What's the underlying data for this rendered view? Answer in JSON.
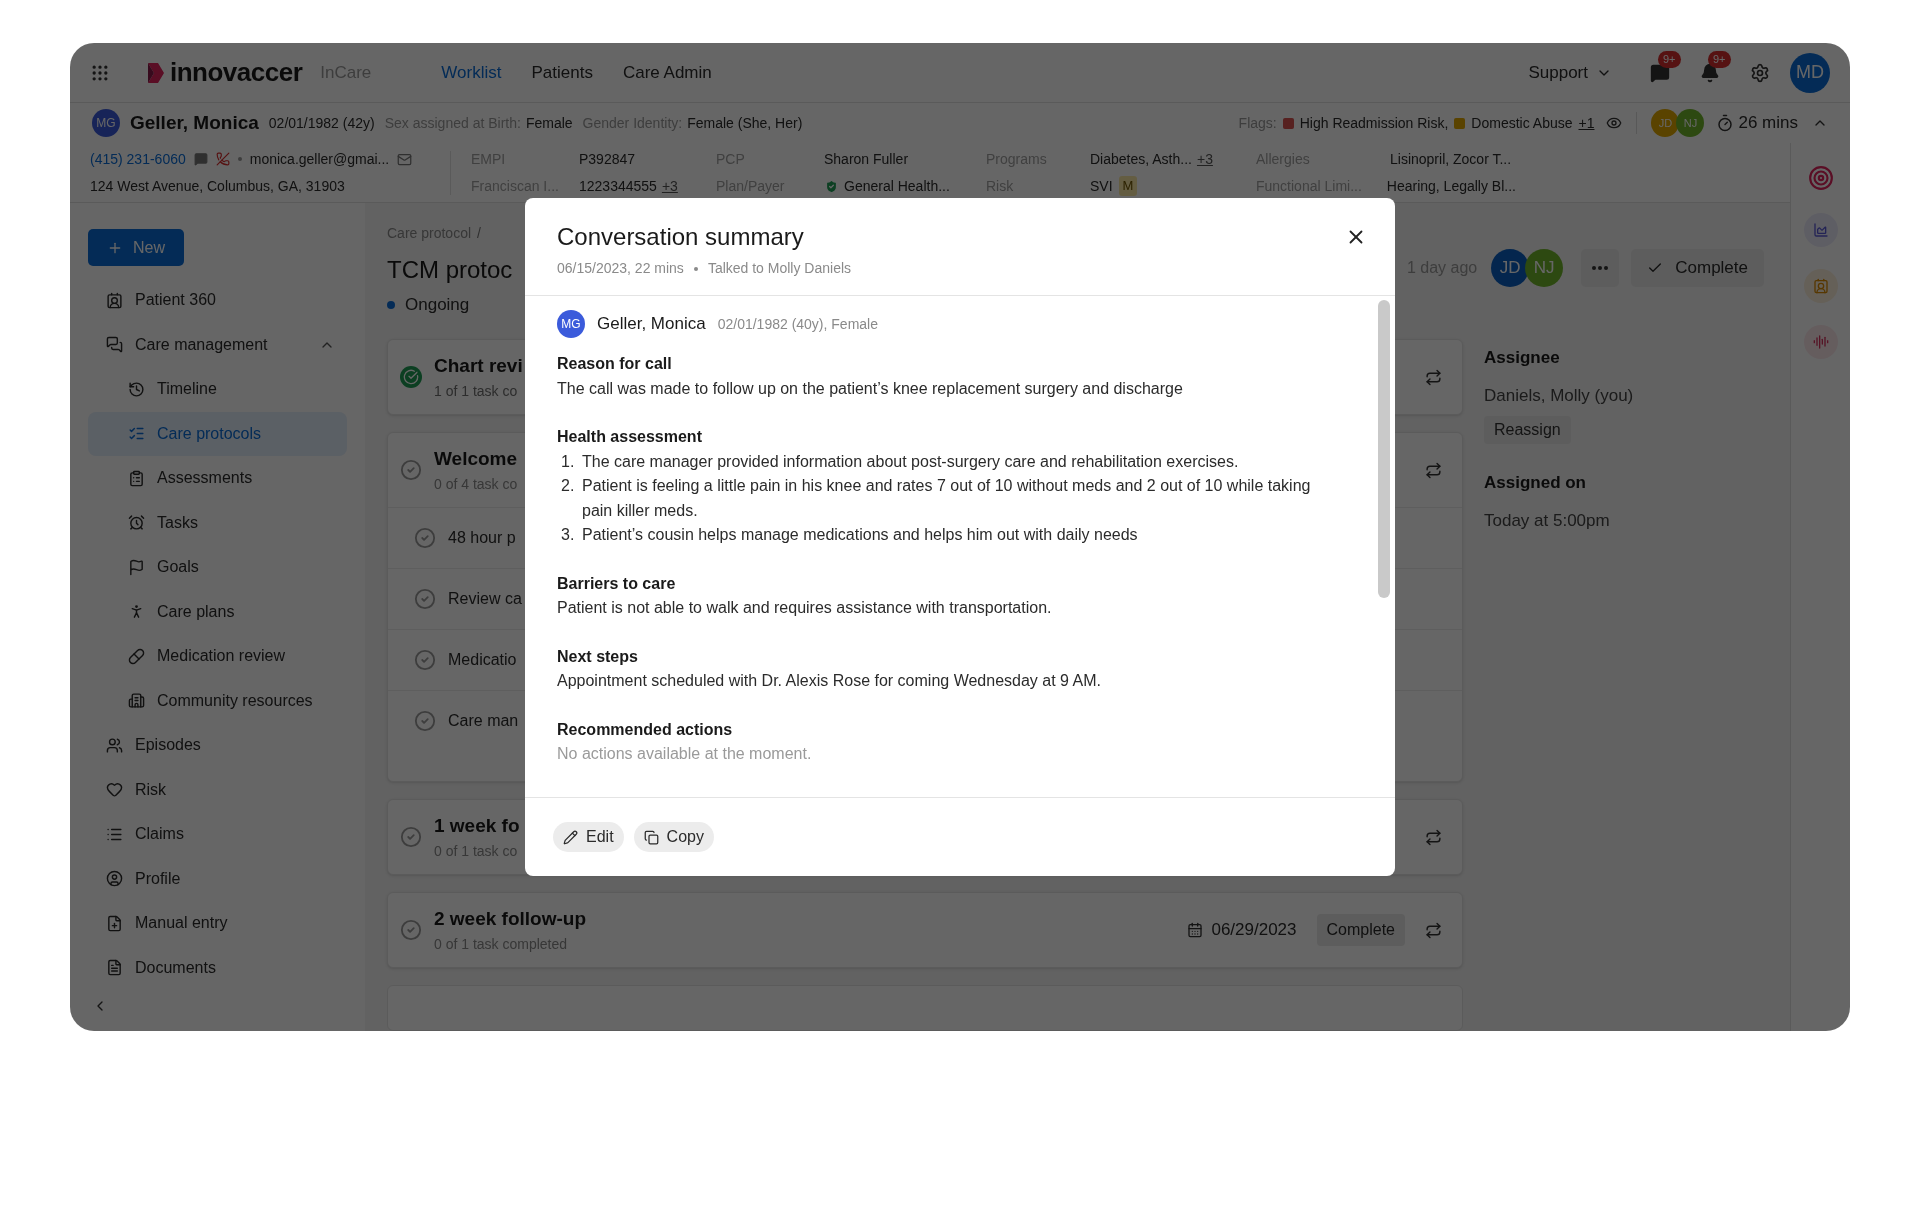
{
  "top_nav": {
    "app_name": "innovaccer",
    "product": "InCare",
    "tabs": [
      {
        "label": "Worklist",
        "selected": true
      },
      {
        "label": "Patients",
        "selected": false
      },
      {
        "label": "Care Admin",
        "selected": false
      }
    ],
    "support": "Support",
    "message_badge": "9+",
    "notification_badge": "9+",
    "user_initials": "MD"
  },
  "patient_header": {
    "initials": "MG",
    "name": "Geller, Monica",
    "dob": "02/01/1982 (42y)",
    "sex_label": "Sex assigned at Birth:",
    "sex": "Female",
    "gender_label": "Gender Identity:",
    "gender": "Female (She, Her)",
    "flags_label": "Flags:",
    "flags": [
      {
        "label": "High Readmission Risk,",
        "color": "#572120"
      },
      {
        "label": "Domestic Abuse",
        "color": "#5a4300"
      }
    ],
    "flags_more": "+1",
    "care_team": [
      {
        "initials": "JD"
      },
      {
        "initials": "NJ"
      }
    ],
    "timer": "26 mins",
    "expanded": true,
    "phone": "(415) 231-6060",
    "email": "monica.geller@gmai...",
    "address": "124 West Avenue, Columbus, GA, 31903",
    "fields": [
      {
        "label": "EMPI",
        "value": "P392847"
      },
      {
        "label": "Franciscan I...",
        "value": "1223344555",
        "more": "+3"
      },
      {
        "label": "PCP",
        "value": "Sharon Fuller"
      },
      {
        "label": "Plan/Payer",
        "value": "General Health...",
        "kind": "verified"
      },
      {
        "label": "Programs",
        "value": "Diabetes, Asth...",
        "more": "+3"
      },
      {
        "label": "Risk",
        "value": "SVI",
        "badge": "M"
      },
      {
        "label": "Allergies",
        "value": "Lisinopril, Zocor T..."
      },
      {
        "label": "Functional Limi...",
        "value": "Hearing, Legally Bl..."
      }
    ]
  },
  "sidebar": {
    "new_button": "New",
    "items": [
      {
        "label": "Patient 360",
        "selected": false
      },
      {
        "label": "Care management",
        "selected": false,
        "expanded": true,
        "children": [
          {
            "label": "Timeline",
            "selected": false
          },
          {
            "label": "Care protocols",
            "selected": true
          },
          {
            "label": "Assessments",
            "selected": false
          },
          {
            "label": "Tasks",
            "selected": false
          },
          {
            "label": "Goals",
            "selected": false
          },
          {
            "label": "Care plans",
            "selected": false
          },
          {
            "label": "Medication review",
            "selected": false
          },
          {
            "label": "Community resources",
            "selected": false
          }
        ]
      },
      {
        "label": "Episodes",
        "selected": false
      },
      {
        "label": "Risk",
        "selected": false
      },
      {
        "label": "Claims",
        "selected": false
      },
      {
        "label": "Profile",
        "selected": false
      },
      {
        "label": "Manual entry",
        "selected": false
      },
      {
        "label": "Documents",
        "selected": false
      }
    ]
  },
  "protocol": {
    "breadcrumb": "Care protocol",
    "separator": "/",
    "title": "TCM protoc",
    "status": "Ongoing",
    "updated": "1 day ago",
    "assignees": [
      {
        "initials": "JD"
      },
      {
        "initials": "NJ"
      }
    ],
    "complete_button": "Complete",
    "cards": [
      {
        "title": "Chart revi",
        "subtitle": "1 of 1 task co",
        "done": true
      },
      {
        "title": "Welcome",
        "subtitle": "0 of 4 task co",
        "done": false,
        "tasks": [
          {
            "label": "48 hour p",
            "done": false
          },
          {
            "label": "Review ca",
            "done": false
          },
          {
            "label": "Medicatio",
            "done": false
          },
          {
            "label": "Care man",
            "done": false
          }
        ]
      },
      {
        "title": "1 week fo",
        "subtitle": "0 of 1 task co",
        "done": false
      },
      {
        "title": "2 week follow-up",
        "subtitle": "0 of 1 task completed",
        "done": false,
        "date": "06/29/2023",
        "action": "Complete"
      }
    ]
  },
  "details": {
    "assignee_label": "Assignee",
    "assignee": "Daniels, Molly (you)",
    "reassign_button": "Reassign",
    "assigned_on_label": "Assigned on",
    "assigned_on": "Today at 5:00pm"
  },
  "modal": {
    "title": "Conversation summary",
    "date": "06/15/2023, 22 mins",
    "talked_to": "Talked to Molly Daniels",
    "patient_initials": "MG",
    "patient_name": "Geller, Monica",
    "patient_details": "02/01/1982 (40y), Female",
    "sections": [
      {
        "kind": "paragraph",
        "heading": "Reason for call",
        "text": "The call was made to follow up on the patient’s knee replacement surgery and discharge"
      },
      {
        "kind": "list",
        "heading": "Health assessment",
        "items": [
          {
            "number": "1.",
            "text": "The care manager provided information about post-surgery care and rehabilitation exercises."
          },
          {
            "number": "2.",
            "text": "Patient is feeling a little pain in his knee and rates 7 out of 10 without meds and 2 out of 10 while taking pain killer meds."
          },
          {
            "number": "3.",
            "text": "Patient’s cousin helps manage medications and helps him out with daily needs"
          }
        ]
      },
      {
        "kind": "paragraph",
        "heading": "Barriers to care",
        "text": "Patient is not able to walk and requires assistance with transportation."
      },
      {
        "kind": "paragraph",
        "heading": "Next steps",
        "text": "Appointment scheduled with Dr. Alexis Rose for coming Wednesday at 9 AM."
      },
      {
        "kind": "empty",
        "heading": "Recommended actions",
        "text": "No actions available at the moment."
      }
    ],
    "buttons": [
      {
        "kind": "edit",
        "label": "Edit"
      },
      {
        "kind": "copy",
        "label": "Copy"
      }
    ]
  }
}
